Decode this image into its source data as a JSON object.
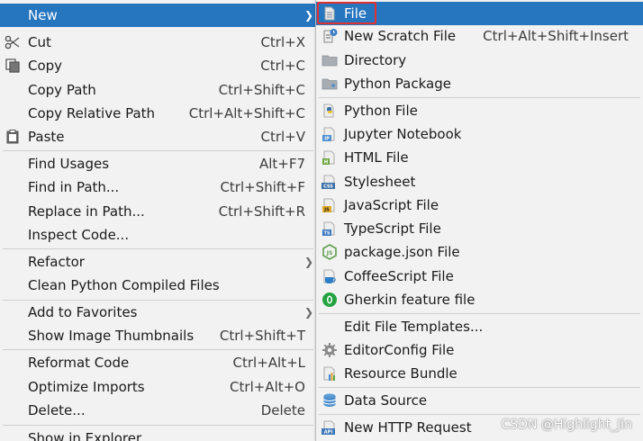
{
  "main_menu": {
    "items": [
      {
        "label": "New",
        "shortcut": "",
        "submenu": true
      },
      {
        "label": "Cut",
        "shortcut": "Ctrl+X",
        "icon": "scissors-icon"
      },
      {
        "label": "Copy",
        "shortcut": "Ctrl+C",
        "icon": "copy-icon"
      },
      {
        "label": "Copy Path",
        "shortcut": "Ctrl+Shift+C"
      },
      {
        "label": "Copy Relative Path",
        "shortcut": "Ctrl+Alt+Shift+C"
      },
      {
        "label": "Paste",
        "shortcut": "Ctrl+V",
        "icon": "clipboard-icon"
      },
      {
        "label": "Find Usages",
        "shortcut": "Alt+F7"
      },
      {
        "label": "Find in Path...",
        "shortcut": "Ctrl+Shift+F"
      },
      {
        "label": "Replace in Path...",
        "shortcut": "Ctrl+Shift+R"
      },
      {
        "label": "Inspect Code...",
        "shortcut": ""
      },
      {
        "label": "Refactor",
        "shortcut": "",
        "submenu": true
      },
      {
        "label": "Clean Python Compiled Files",
        "shortcut": ""
      },
      {
        "label": "Add to Favorites",
        "shortcut": "",
        "submenu": true
      },
      {
        "label": "Show Image Thumbnails",
        "shortcut": "Ctrl+Shift+T"
      },
      {
        "label": "Reformat Code",
        "shortcut": "Ctrl+Alt+L"
      },
      {
        "label": "Optimize Imports",
        "shortcut": "Ctrl+Alt+O"
      },
      {
        "label": "Delete...",
        "shortcut": "Delete"
      },
      {
        "label": "Show in Explorer",
        "shortcut": ""
      }
    ]
  },
  "sub_menu": {
    "items": [
      {
        "label": "File",
        "shortcut": "",
        "icon": "file-icon"
      },
      {
        "label": "New Scratch File",
        "shortcut": "Ctrl+Alt+Shift+Insert",
        "icon": "scratch-file-icon"
      },
      {
        "label": "Directory",
        "shortcut": "",
        "icon": "folder-icon"
      },
      {
        "label": "Python Package",
        "shortcut": "",
        "icon": "package-folder-icon"
      },
      {
        "label": "Python File",
        "shortcut": "",
        "icon": "python-icon"
      },
      {
        "label": "Jupyter Notebook",
        "shortcut": "",
        "icon": "jupyter-icon"
      },
      {
        "label": "HTML File",
        "shortcut": "",
        "icon": "html-icon"
      },
      {
        "label": "Stylesheet",
        "shortcut": "",
        "icon": "css-icon"
      },
      {
        "label": "JavaScript File",
        "shortcut": "",
        "icon": "javascript-icon"
      },
      {
        "label": "TypeScript File",
        "shortcut": "",
        "icon": "typescript-icon"
      },
      {
        "label": "package.json File",
        "shortcut": "",
        "icon": "nodejs-icon"
      },
      {
        "label": "CoffeeScript File",
        "shortcut": "",
        "icon": "coffeescript-icon"
      },
      {
        "label": "Gherkin feature file",
        "shortcut": "",
        "icon": "gherkin-icon"
      },
      {
        "label": "Edit File Templates...",
        "shortcut": ""
      },
      {
        "label": "EditorConfig File",
        "shortcut": "",
        "icon": "gear-icon"
      },
      {
        "label": "Resource Bundle",
        "shortcut": "",
        "icon": "resource-bundle-icon"
      },
      {
        "label": "Data Source",
        "shortcut": "",
        "icon": "database-icon"
      },
      {
        "label": "New HTTP Request",
        "shortcut": "",
        "icon": "api-icon"
      }
    ]
  },
  "watermark": "CSDN @Highlight_Jin",
  "colors": {
    "selected_bg": "#2675bf",
    "highlight_border": "#e03030"
  }
}
